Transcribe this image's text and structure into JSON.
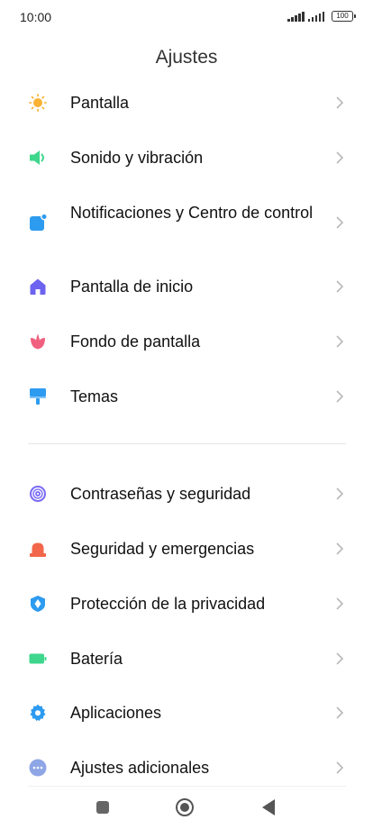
{
  "status_bar": {
    "time": "10:00",
    "battery": "100"
  },
  "header": {
    "title": "Ajustes"
  },
  "sections": {
    "display": "Pantalla",
    "sound": "Sonido y vibración",
    "notifications": "Notificaciones y Centro de control",
    "home_screen": "Pantalla de inicio",
    "wallpaper": "Fondo de pantalla",
    "themes": "Temas",
    "passwords": "Contraseñas y seguridad",
    "safety": "Seguridad y emergencias",
    "privacy": "Protección de la privacidad",
    "battery": "Batería",
    "apps": "Aplicaciones",
    "additional": "Ajustes adicionales"
  },
  "icons": {
    "display": "sun-icon",
    "sound": "speaker-icon",
    "notifications": "notification-icon",
    "home_screen": "home-icon",
    "wallpaper": "flower-icon",
    "themes": "paint-roller-icon",
    "passwords": "fingerprint-icon",
    "safety": "siren-icon",
    "privacy": "shield-icon",
    "battery": "battery-icon",
    "apps": "gear-icon",
    "additional": "more-icon"
  },
  "colors": {
    "display": "#F9B233",
    "sound": "#3DD68C",
    "notifications": "#2D9BF0",
    "home_screen": "#6C63F0",
    "wallpaper": "#F0607E",
    "themes": "#2D9BF0",
    "passwords": "#7B6CF6",
    "safety": "#F2664A",
    "privacy": "#2D9BF0",
    "battery": "#3DD68C",
    "apps": "#2D9BF0",
    "additional": "#8EA6E6"
  }
}
